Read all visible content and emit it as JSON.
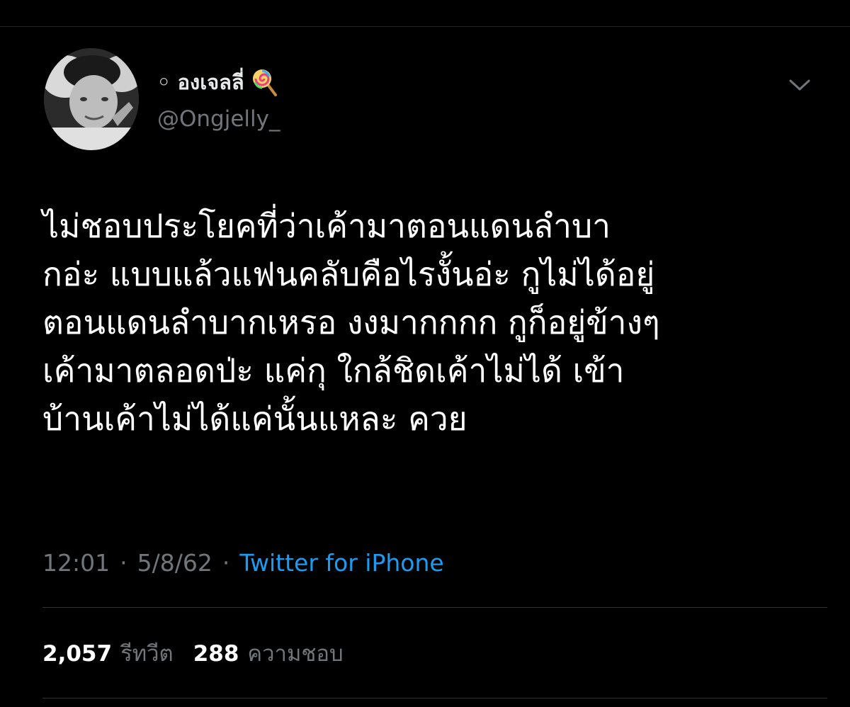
{
  "user": {
    "display_name": "◦ องเจลลี่",
    "emoji_icon": "lollipop-icon",
    "handle": "@Ongjelly_"
  },
  "tweet": {
    "lines": [
      "ไม่ชอบประโยคที่ว่าเค้ามาตอนแดนลำบา",
      "กอ่ะ แบบแล้วแฟนคลับคือไรงั้นอ่ะ กูไม่ได้อยู่",
      "ตอนแดนลำบากเหรอ งงมากกกก กูก็อยู่ข้างๆ",
      "เค้ามาตลอดป่ะ แค่กุ ใกล้ชิดเค้าไม่ได้ เข้า",
      "บ้านเค้าไม่ได้แค่นั้นแหละ ควย"
    ],
    "time": "12:01",
    "date": "5/8/62",
    "separator": "·",
    "source": "Twitter for iPhone"
  },
  "stats": {
    "retweets_count": "2,057",
    "retweets_label": "รีทวีต",
    "likes_count": "288",
    "likes_label": "ความชอบ"
  },
  "colors": {
    "background": "#000000",
    "text": "#ffffff",
    "secondary_text": "#71767b",
    "link": "#1d9bf0",
    "divider": "#2f3336"
  }
}
